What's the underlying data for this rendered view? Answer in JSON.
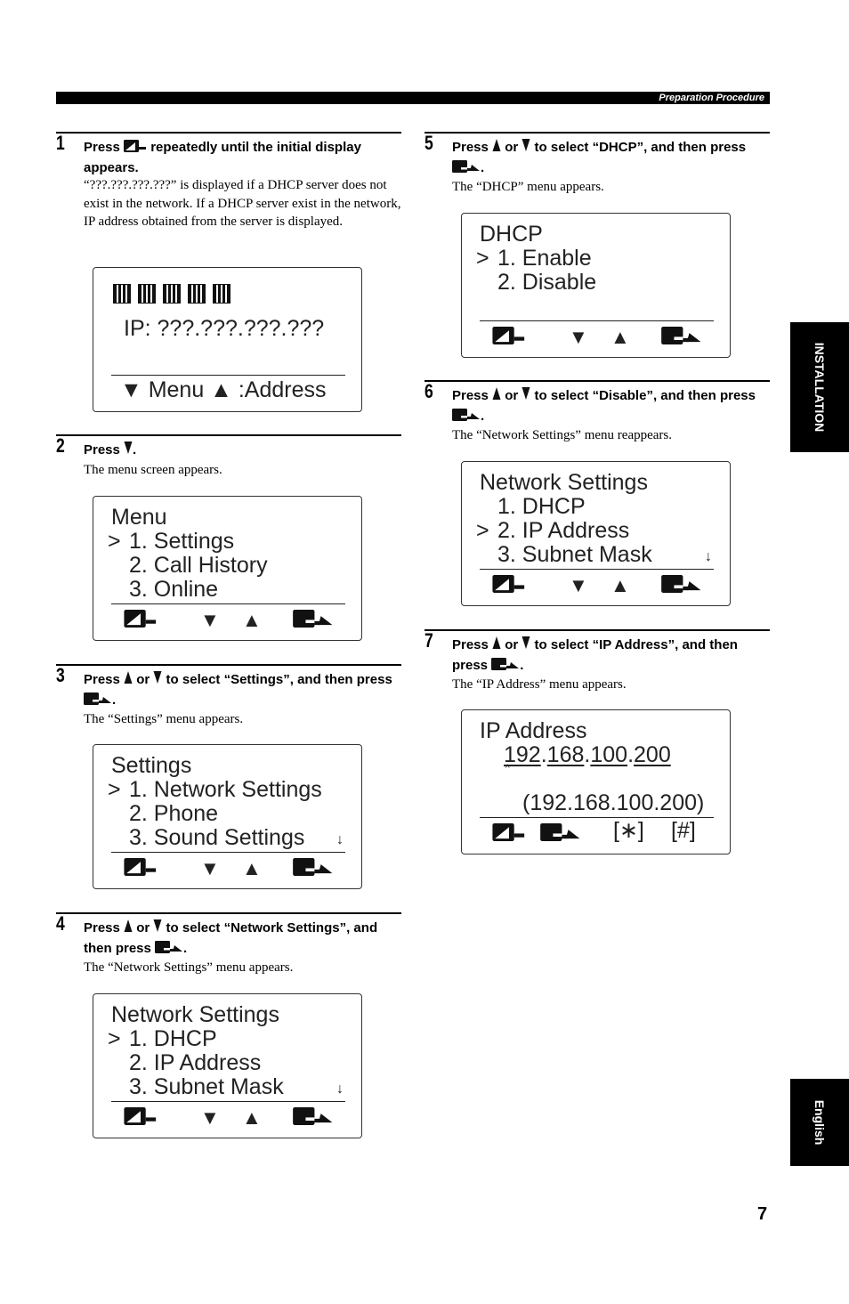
{
  "header": {
    "section": "Preparation Procedure"
  },
  "side_tabs": {
    "installation": "INSTALLATION",
    "language": "English"
  },
  "page_number": "7",
  "steps": [
    {
      "num": "1",
      "instruction": [
        {
          "text": "Press "
        },
        {
          "icon": "back"
        },
        {
          "text": " repeatedly until the initial display appears."
        }
      ],
      "body": "“???.???.???.???” is displayed if a DHCP server does not exist in the network. If a DHCP server exist in the network, IP address obtained from the server is displayed.",
      "lcd": {
        "type": "initial",
        "status_icons": [
          "ip-icon",
          "lan-icon",
          "mute-icon",
          "sip-icon",
          "home-icon"
        ],
        "ip": "IP: ???.???.???.???",
        "footer": "▼ Menu ▲ :Address"
      }
    },
    {
      "num": "2",
      "instruction": [
        {
          "text": "Press "
        },
        {
          "icon": "down"
        },
        {
          "text": "."
        }
      ],
      "body": "The menu screen appears.",
      "lcd": {
        "type": "menu",
        "lines": [
          {
            "text": "Menu"
          },
          {
            "text": "1. Settings",
            "indent": true,
            "cursor": true
          },
          {
            "text": "2. Call History",
            "indent": true
          },
          {
            "text": "3. Online",
            "indent": true
          }
        ],
        "scroll": false
      }
    },
    {
      "num": "3",
      "instruction": [
        {
          "text": "Press "
        },
        {
          "icon": "up"
        },
        {
          "text": " or "
        },
        {
          "icon": "down"
        },
        {
          "text": " to select “Settings”, and then press "
        },
        {
          "icon": "enter"
        },
        {
          "text": "."
        }
      ],
      "body": "The “Settings” menu appears.",
      "lcd": {
        "type": "menu",
        "lines": [
          {
            "text": "Settings"
          },
          {
            "text": "1. Network Settings",
            "indent": true,
            "cursor": true
          },
          {
            "text": "2. Phone",
            "indent": true
          },
          {
            "text": "3. Sound Settings",
            "indent": true
          }
        ],
        "scroll": true
      }
    },
    {
      "num": "4",
      "instruction": [
        {
          "text": "Press "
        },
        {
          "icon": "up"
        },
        {
          "text": " or "
        },
        {
          "icon": "down"
        },
        {
          "text": " to select “Network Settings”, and then press "
        },
        {
          "icon": "enter"
        },
        {
          "text": "."
        }
      ],
      "body": "The “Network Settings” menu appears.",
      "lcd": {
        "type": "menu",
        "lines": [
          {
            "text": "Network Settings"
          },
          {
            "text": "1. DHCP",
            "indent": true,
            "cursor": true
          },
          {
            "text": "2. IP Address",
            "indent": true
          },
          {
            "text": "3. Subnet Mask",
            "indent": true
          }
        ],
        "scroll": true
      }
    },
    {
      "num": "5",
      "instruction": [
        {
          "text": "Press "
        },
        {
          "icon": "up"
        },
        {
          "text": " or "
        },
        {
          "icon": "down"
        },
        {
          "text": " to select “DHCP”, and then press "
        },
        {
          "icon": "enter"
        },
        {
          "text": "."
        }
      ],
      "body": "The “DHCP” menu appears.",
      "lcd": {
        "type": "menu",
        "lines": [
          {
            "text": "DHCP"
          },
          {
            "text": "1. Enable",
            "indent": true,
            "cursor": true
          },
          {
            "text": "2. Disable",
            "indent": true
          }
        ],
        "scroll": false
      }
    },
    {
      "num": "6",
      "instruction": [
        {
          "text": "Press "
        },
        {
          "icon": "up"
        },
        {
          "text": " or "
        },
        {
          "icon": "down"
        },
        {
          "text": " to select “Disable”, and then press "
        },
        {
          "icon": "enter"
        },
        {
          "text": "."
        }
      ],
      "body": "The “Network Settings” menu reappears.",
      "lcd": {
        "type": "menu",
        "lines": [
          {
            "text": "Network Settings"
          },
          {
            "text": "1. DHCP",
            "indent": true
          },
          {
            "text": "2. IP Address",
            "indent": true,
            "cursor": true
          },
          {
            "text": "3. Subnet Mask",
            "indent": true
          }
        ],
        "scroll": true
      }
    },
    {
      "num": "7",
      "instruction": [
        {
          "text": "Press "
        },
        {
          "icon": "up"
        },
        {
          "text": " or "
        },
        {
          "icon": "down"
        },
        {
          "text": " to select “IP Address”, and then press "
        },
        {
          "icon": "enter"
        },
        {
          "text": "."
        }
      ],
      "body": "The “IP Address” menu appears.",
      "lcd": {
        "type": "ipedit",
        "title": "IP Address",
        "octets": [
          "192",
          "168",
          "100",
          "200"
        ],
        "current": "(192.168.100.200)",
        "key_star": "[∗]",
        "key_hash": "[#]"
      }
    }
  ],
  "lcd_common": {
    "cursor": ">",
    "down": "▼",
    "up": "▲",
    "scroll": "↓"
  }
}
